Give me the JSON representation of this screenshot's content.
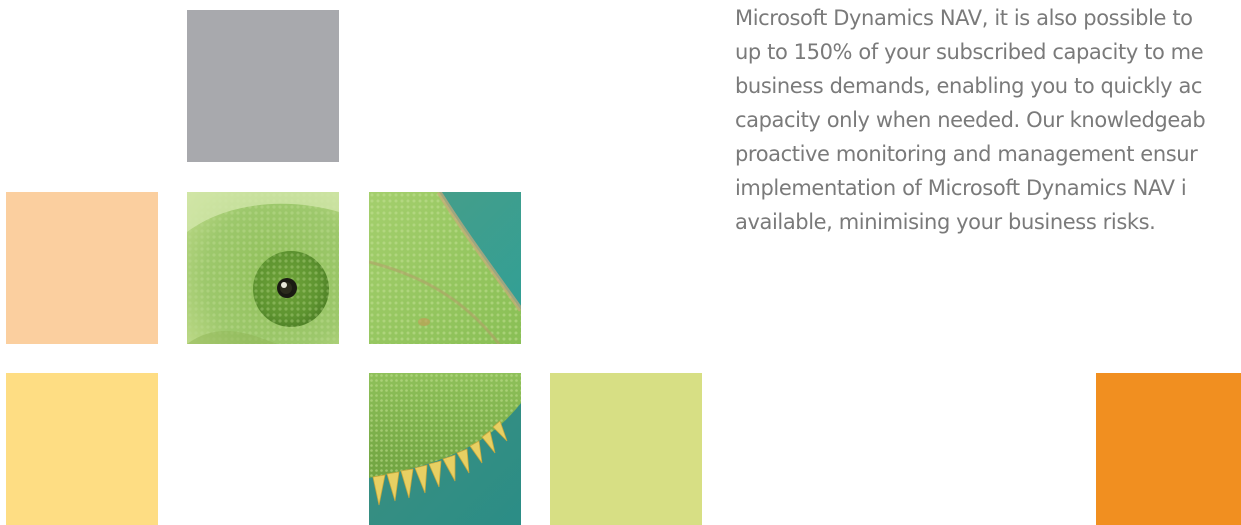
{
  "tiles": {
    "gray": {
      "color": "#a8a9ad"
    },
    "peach": {
      "color": "#fbcf9f"
    },
    "yellow": {
      "color": "#fedd83"
    },
    "lime": {
      "color": "#d7df84"
    },
    "orange": {
      "color": "#f18f20"
    },
    "eye_photo": {
      "icon": "chameleon-eye-photo"
    },
    "crest_photo": {
      "icon": "chameleon-crest-photo"
    },
    "spikes_photo": {
      "icon": "chameleon-spikes-photo"
    }
  },
  "paragraph": {
    "lines": [
      "Microsoft Dynamics NAV, it is also possible to",
      "up to 150% of your subscribed capacity to me",
      "business demands, enabling you to quickly ac",
      "capacity only when needed. Our knowledgeab",
      "proactive monitoring and management ensur",
      "implementation of Microsoft Dynamics NAV i",
      "available, minimising your business risks."
    ]
  }
}
